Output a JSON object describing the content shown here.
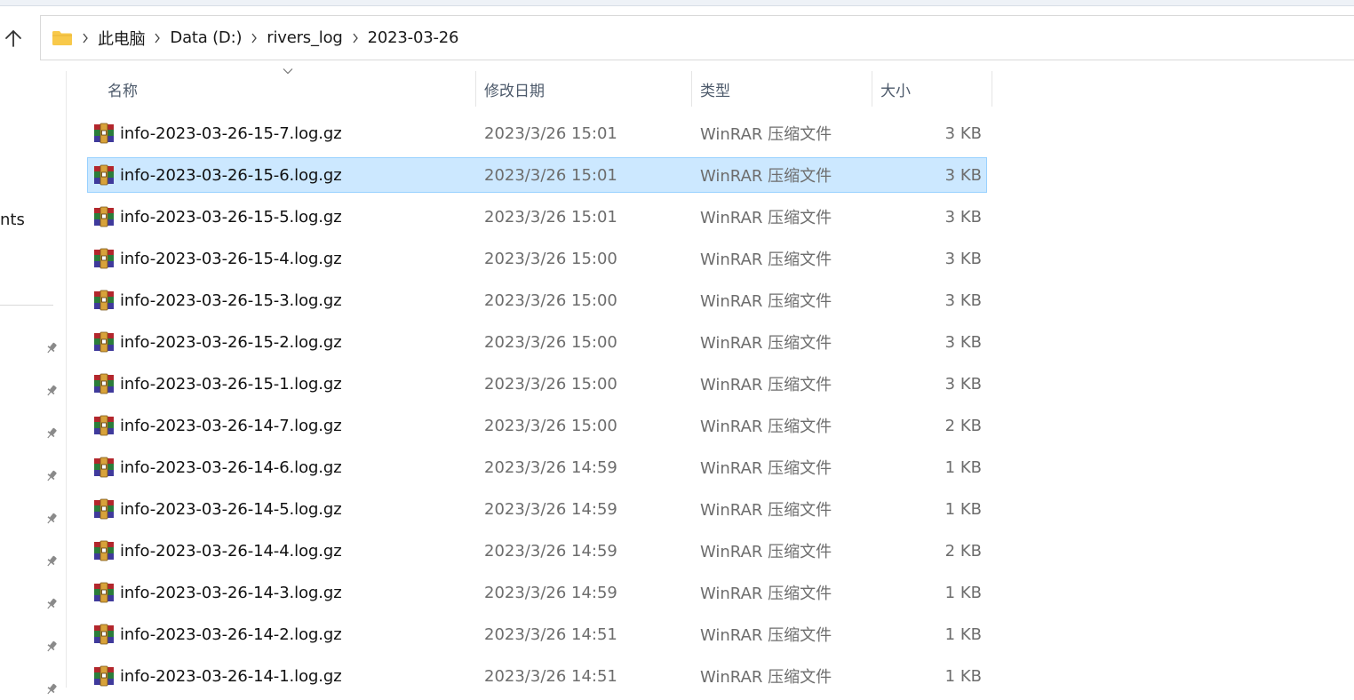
{
  "breadcrumb": [
    "此电脑",
    "Data (D:)",
    "rivers_log",
    "2023-03-26"
  ],
  "nav": {
    "partial_label": "nts"
  },
  "columns": {
    "name": "名称",
    "date": "修改日期",
    "type": "类型",
    "size": "大小"
  },
  "files": [
    {
      "name": "info-2023-03-26-15-7.log.gz",
      "date": "2023/3/26 15:01",
      "type": "WinRAR 压缩文件",
      "size": "3 KB",
      "selected": false
    },
    {
      "name": "info-2023-03-26-15-6.log.gz",
      "date": "2023/3/26 15:01",
      "type": "WinRAR 压缩文件",
      "size": "3 KB",
      "selected": true
    },
    {
      "name": "info-2023-03-26-15-5.log.gz",
      "date": "2023/3/26 15:01",
      "type": "WinRAR 压缩文件",
      "size": "3 KB",
      "selected": false
    },
    {
      "name": "info-2023-03-26-15-4.log.gz",
      "date": "2023/3/26 15:00",
      "type": "WinRAR 压缩文件",
      "size": "3 KB",
      "selected": false
    },
    {
      "name": "info-2023-03-26-15-3.log.gz",
      "date": "2023/3/26 15:00",
      "type": "WinRAR 压缩文件",
      "size": "3 KB",
      "selected": false
    },
    {
      "name": "info-2023-03-26-15-2.log.gz",
      "date": "2023/3/26 15:00",
      "type": "WinRAR 压缩文件",
      "size": "3 KB",
      "selected": false
    },
    {
      "name": "info-2023-03-26-15-1.log.gz",
      "date": "2023/3/26 15:00",
      "type": "WinRAR 压缩文件",
      "size": "3 KB",
      "selected": false
    },
    {
      "name": "info-2023-03-26-14-7.log.gz",
      "date": "2023/3/26 15:00",
      "type": "WinRAR 压缩文件",
      "size": "2 KB",
      "selected": false
    },
    {
      "name": "info-2023-03-26-14-6.log.gz",
      "date": "2023/3/26 14:59",
      "type": "WinRAR 压缩文件",
      "size": "1 KB",
      "selected": false
    },
    {
      "name": "info-2023-03-26-14-5.log.gz",
      "date": "2023/3/26 14:59",
      "type": "WinRAR 压缩文件",
      "size": "1 KB",
      "selected": false
    },
    {
      "name": "info-2023-03-26-14-4.log.gz",
      "date": "2023/3/26 14:59",
      "type": "WinRAR 压缩文件",
      "size": "2 KB",
      "selected": false
    },
    {
      "name": "info-2023-03-26-14-3.log.gz",
      "date": "2023/3/26 14:59",
      "type": "WinRAR 压缩文件",
      "size": "1 KB",
      "selected": false
    },
    {
      "name": "info-2023-03-26-14-2.log.gz",
      "date": "2023/3/26 14:51",
      "type": "WinRAR 压缩文件",
      "size": "1 KB",
      "selected": false
    },
    {
      "name": "info-2023-03-26-14-1.log.gz",
      "date": "2023/3/26 14:51",
      "type": "WinRAR 压缩文件",
      "size": "1 KB",
      "selected": false
    }
  ],
  "icons": {
    "up": "up-arrow-icon",
    "folder": "folder-icon",
    "separator": "chevron-right-icon",
    "sort": "chevron-down-icon",
    "file": "winrar-archive-icon",
    "pin": "pin-icon"
  },
  "colors": {
    "selection_bg": "#cce8ff",
    "selection_border": "#99d1ff",
    "folder_yellow": "#f8c94a",
    "header_text": "#4d5a6b",
    "muted_text": "#6d6d6d"
  }
}
